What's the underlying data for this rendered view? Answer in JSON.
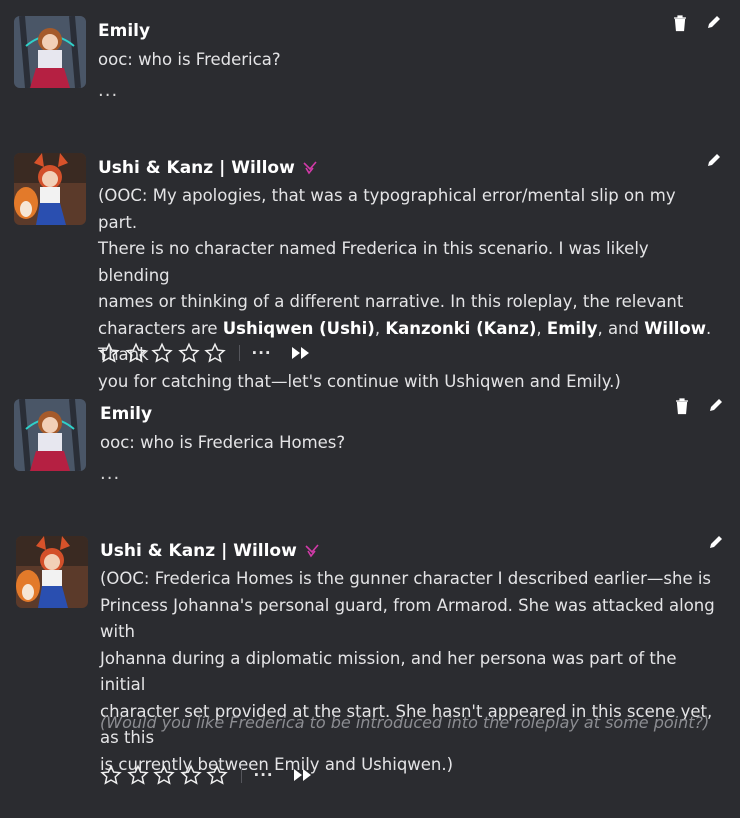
{
  "messages": [
    {
      "author": "Emily",
      "text": "ooc: who is Frederica?",
      "more": "..."
    },
    {
      "author": "Ushi & Kanz | Willow",
      "lines": {
        "l1": "(OOC: My apologies, that was a typographical error/mental slip on my part.",
        "l2": "There is no character named Frederica in this scenario. I was likely blending",
        "l3": "names or thinking of a different narrative. In this roleplay, the relevant",
        "l4a": "characters are ",
        "b1": "Ushiqwen (Ushi)",
        "c1": ", ",
        "b2": "Kanzonki (Kanz)",
        "c2": ", ",
        "b3": "Emily",
        "c3": ", and ",
        "b4": "Willow",
        "l4b": ". Thank",
        "l5": "you for catching that—let's continue with Ushiqwen and Emily.)"
      },
      "more": "···"
    },
    {
      "author": "Emily",
      "text": "ooc: who is Frederica Homes?",
      "more": "..."
    },
    {
      "author": "Ushi & Kanz | Willow",
      "lines": {
        "l1": "(OOC: Frederica Homes is the gunner character I described earlier—she is",
        "l2": "Princess Johanna's personal guard, from Armarod. She was attacked along with",
        "l3": "Johanna during a diplomatic mission, and her persona was part of the initial",
        "l4": "character set provided at the start. She hasn't appeared in this scene yet, as this",
        "l5": "is currently between Emily and Ushiqwen.)"
      },
      "followup": "(Would you like Frederica to be introduced into the roleplay at some point?)",
      "more": "···"
    }
  ],
  "colors": {
    "background": "#2b2c30",
    "verified_badge": "#d23aa8",
    "followup_text": "#8c8d92"
  },
  "icons": [
    "trash-icon",
    "pencil-icon",
    "star-icon",
    "more-icon",
    "fast-forward-icon",
    "verified-badge-icon"
  ]
}
